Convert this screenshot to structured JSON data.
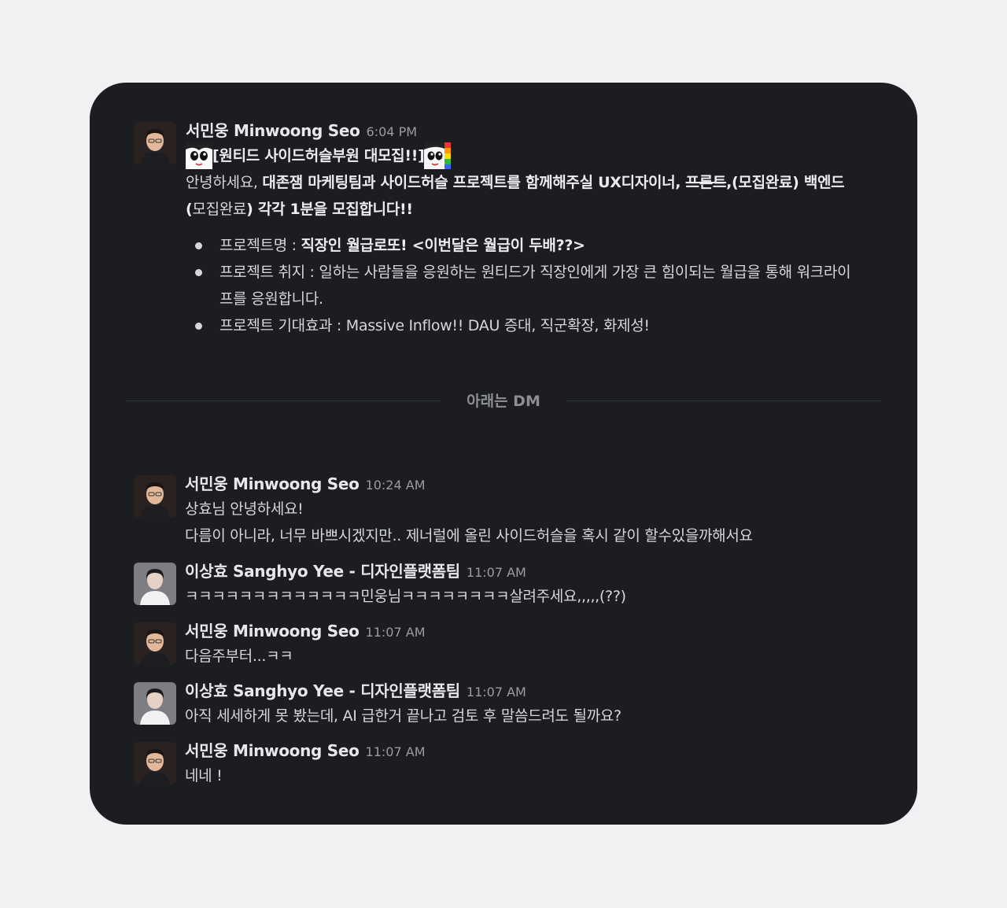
{
  "divider_label": "아래는 DM",
  "colors": {
    "page_background": "#f0f1f3",
    "card_background": "#1b1d21",
    "name_text": "#e8e8ea",
    "body_text": "#d6d7da",
    "timestamp_text": "#9a9ca2"
  },
  "post": {
    "author": "서민웅 Minwoong Seo",
    "time": "6:04 PM",
    "title": "[원티드 사이드허슬부원 대모집!!]",
    "intro_prefix": "안녕하세요, ",
    "intro_bold": "대존잼 마케팅팀과 사이드허슬 프로젝트를 함께해주실 UX디자이너, ",
    "intro_strike": "프론트",
    "intro_bold_2": ",(모집완료) 백엔드(",
    "intro_normal_2": "모집완료",
    "intro_bold_3": ") 각각 1분을 모집합니다!!",
    "bullets": [
      {
        "label": "프로젝트명 : ",
        "value": "직장인 월급로또! <이번달은 월급이 두배??>",
        "bold": true
      },
      {
        "label": "프로젝트 취지 : ",
        "value": "일하는 사람들을 응원하는 원티드가 직장인에게 가장 큰 힘이되는 월급을 통해 워크라이프를 응원합니다.",
        "bold": false
      },
      {
        "label": "프로젝트 기대효과 : ",
        "value": "Massive Inflow!! DAU 증대, 직군확장, 화제성!",
        "bold": false
      }
    ]
  },
  "dm": [
    {
      "author": "서민웅 Minwoong Seo",
      "time": "10:24 AM",
      "lines": [
        "상효님 안녕하세요!",
        "다름이 아니라, 너무 바쁘시겠지만.. 제너럴에 올린 사이드허슬을 혹시 같이 할수있을까해서요"
      ]
    },
    {
      "author": "이상효 Sanghyo Yee - 디자인플랫폼팀",
      "time": "11:07 AM",
      "lines": [
        "ㅋㅋㅋㅋㅋㅋㅋㅋㅋㅋㅋㅋㅋ민웅님ㅋㅋㅋㅋㅋㅋㅋㅋ살려주세요,,,,,(??)"
      ]
    },
    {
      "author": "서민웅 Minwoong Seo",
      "time": "11:07 AM",
      "lines": [
        "다음주부터...ㅋㅋ"
      ]
    },
    {
      "author": "이상효 Sanghyo Yee - 디자인플랫폼팀",
      "time": "11:07 AM",
      "lines": [
        "아직 세세하게 못 봤는데, AI 급한거 끝나고 검토 후 말씀드려도 될까요?"
      ]
    },
    {
      "author": "서민웅 Minwoong Seo",
      "time": "11:07 AM",
      "lines": [
        "네네 !"
      ]
    }
  ]
}
